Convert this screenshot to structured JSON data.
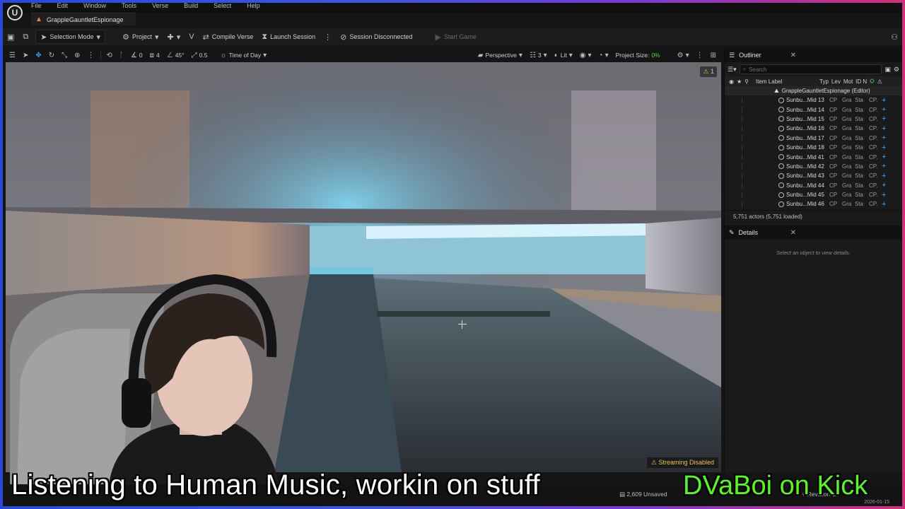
{
  "document_tab": "GrappleGauntletEspionage",
  "menus": [
    "File",
    "Edit",
    "Window",
    "Tools",
    "Verse",
    "Build",
    "Select",
    "Help"
  ],
  "toolbar": {
    "selection_mode": "Selection Mode",
    "project": "Project",
    "compile_verse": "Compile Verse",
    "launch_session": "Launch Session",
    "session_status": "Session Disconnected",
    "start_game": "Start Game"
  },
  "viewport_toolbar": {
    "rotation_snap": "0",
    "scale_snap_count": "4",
    "angle_snap": "45°",
    "scale_snap": "0.5",
    "time_of_day": "Time of Day",
    "perspective": "Perspective",
    "view_count": "3",
    "lit": "Lit",
    "project_size_label": "Project Size:",
    "project_size_value": "0%"
  },
  "viewport": {
    "warning_count": "1",
    "streaming": "Streaming Disabled"
  },
  "outliner": {
    "title": "Outliner",
    "search_placeholder": "Search",
    "columns": {
      "item_label": "Item Label",
      "type": "Typ",
      "level": "Lev",
      "mod": "Mot",
      "id": "ID N"
    },
    "root": "GrappleGauntletEspionage (Editor)",
    "rows": [
      {
        "name": "Sunbu...Mid 13",
        "type": "CP",
        "lev": "Gra",
        "mod": "Sta",
        "id": "CP."
      },
      {
        "name": "Sunbu...Mid 14",
        "type": "CP",
        "lev": "Gra",
        "mod": "Sta",
        "id": "CP."
      },
      {
        "name": "Sunbu...Mid 15",
        "type": "CP",
        "lev": "Gra",
        "mod": "Sta",
        "id": "CP."
      },
      {
        "name": "Sunbu...Mid 16",
        "type": "CP",
        "lev": "Gra",
        "mod": "Sta",
        "id": "CP."
      },
      {
        "name": "Sunbu...Mid 17",
        "type": "CP",
        "lev": "Gra",
        "mod": "Sta",
        "id": "CP."
      },
      {
        "name": "Sunbu...Mid 18",
        "type": "CP",
        "lev": "Gra",
        "mod": "Sta",
        "id": "CP."
      },
      {
        "name": "Sunbu...Mid 41",
        "type": "CP",
        "lev": "Gra",
        "mod": "Sta",
        "id": "CP."
      },
      {
        "name": "Sunbu...Mid 42",
        "type": "CP",
        "lev": "Gra",
        "mod": "Sta",
        "id": "CP."
      },
      {
        "name": "Sunbu...Mid 43",
        "type": "CP",
        "lev": "Gra",
        "mod": "Sta",
        "id": "CP."
      },
      {
        "name": "Sunbu...Mid 44",
        "type": "CP",
        "lev": "Gra",
        "mod": "Sta",
        "id": "CP."
      },
      {
        "name": "Sunbu...Mid 45",
        "type": "CP",
        "lev": "Gra",
        "mod": "Sta",
        "id": "CP."
      },
      {
        "name": "Sunbu...Mid 46",
        "type": "CP",
        "lev": "Gra",
        "mod": "Sta",
        "id": "CP."
      }
    ],
    "actor_count": "5,751 actors (5,751 loaded)"
  },
  "details": {
    "title": "Details",
    "hint": "Select an object to view details."
  },
  "statusbar": {
    "unsaved": "2,609 Unsaved",
    "revision": "Revision C"
  },
  "overlay": {
    "caption": "Listening to Human Music, workin on stuff",
    "channel": "DVaBoi on Kick",
    "date": "2026-01-15"
  },
  "colors": {
    "frame_left": "#2a49d8",
    "frame_right": "#d2307a",
    "kick_green": "#53fc18",
    "warning_yellow": "#f2b630"
  }
}
